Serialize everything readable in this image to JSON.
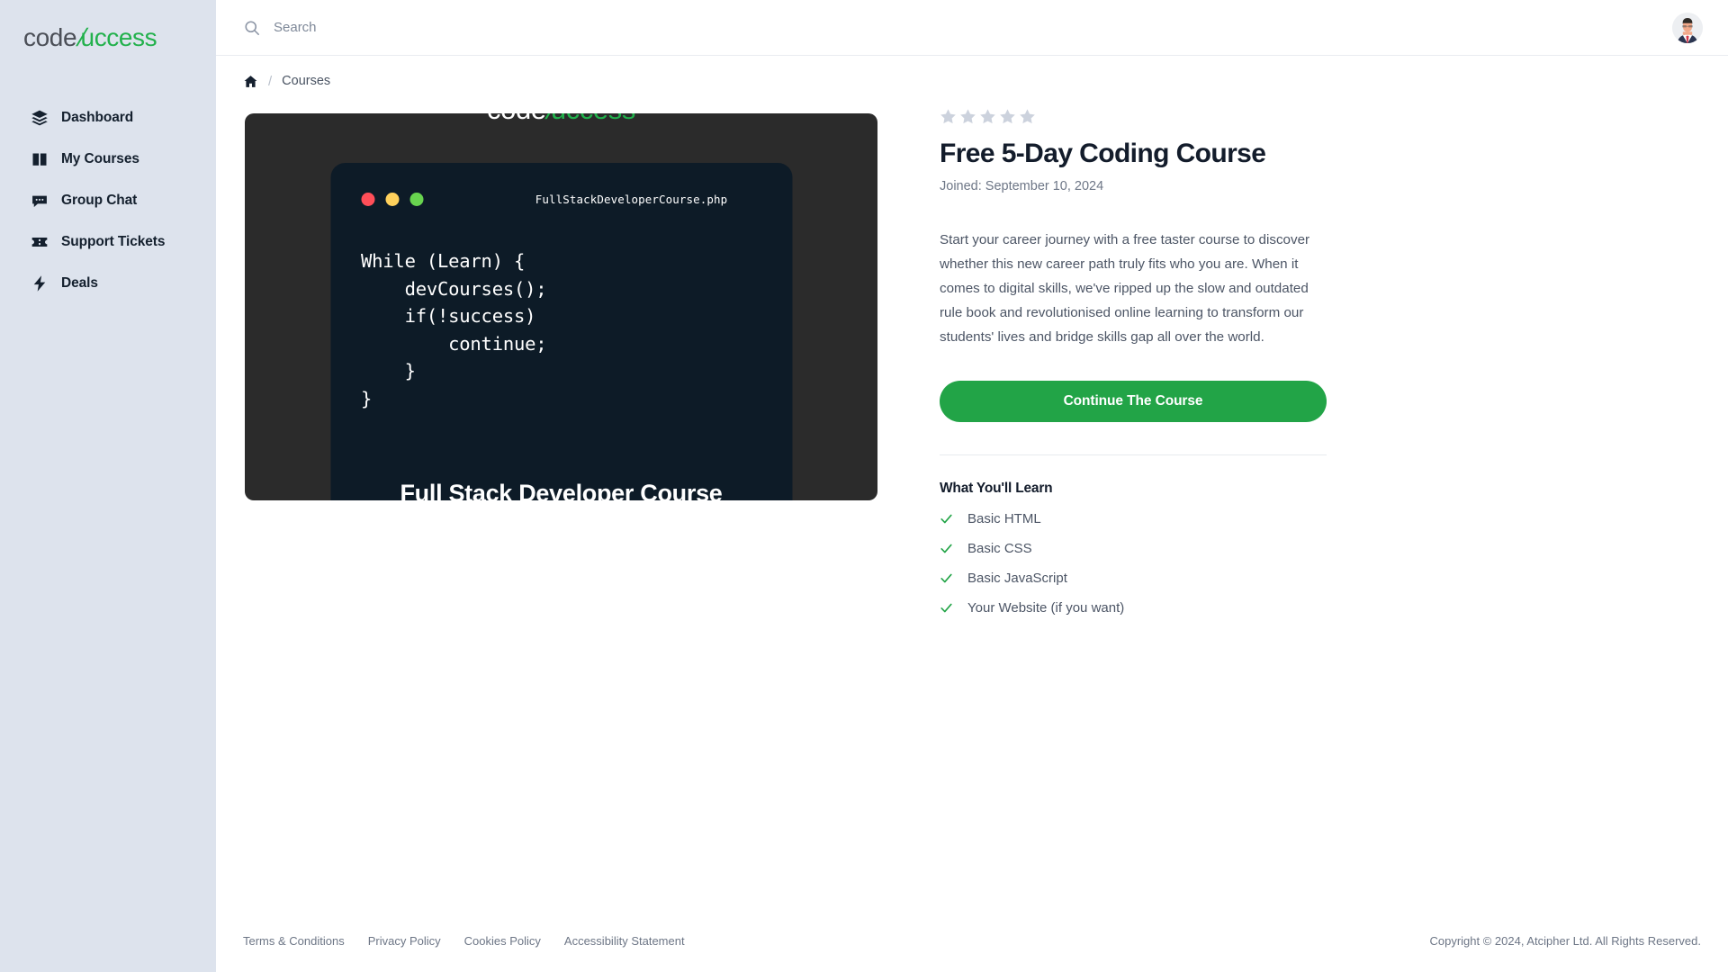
{
  "brand": {
    "name_prefix": "code",
    "name_slash": "/",
    "name_suffix": "uccess"
  },
  "sidebar": {
    "items": [
      {
        "label": "Dashboard",
        "icon": "layers-icon"
      },
      {
        "label": "My Courses",
        "icon": "book-icon"
      },
      {
        "label": "Group Chat",
        "icon": "chat-icon"
      },
      {
        "label": "Support Tickets",
        "icon": "ticket-icon"
      },
      {
        "label": "Deals",
        "icon": "bolt-icon"
      }
    ]
  },
  "topbar": {
    "search_placeholder": "Search",
    "search_value": "",
    "search_icon": "search-icon",
    "avatar_icon": "user-avatar"
  },
  "breadcrumb": {
    "home_icon": "home-icon",
    "separator": "/",
    "current": "Courses"
  },
  "promo": {
    "logo_prefix": "code",
    "logo_slash": "/",
    "logo_suffix": "uccess",
    "filename": "FullStackDeveloperCourse.php",
    "code": "While (Learn) {\n    devCourses();\n    if(!success)\n        continue;\n    }\n}",
    "caption": "Full Stack Developer Course",
    "dots": [
      "red",
      "yellow",
      "green"
    ],
    "colors": {
      "card_bg": "#2b2b2b",
      "window_bg": "#0d1b27",
      "dot_red": "#ff4e58",
      "dot_yellow": "#ffd15c",
      "dot_green": "#68d44f"
    }
  },
  "course": {
    "rating_stars_total": 5,
    "rating_stars_filled": 0,
    "star_color": "#ccd2dd",
    "title": "Free 5-Day Coding Course",
    "joined": "Joined: September 10, 2024",
    "description": "Start your career journey with a free taster course to discover whether this new career path truly fits who you are. When it comes to digital skills, we've ripped up the slow and outdated rule book and revolutionised online learning to transform our students' lives and bridge skills gap all over the world.",
    "cta_label": "Continue The Course",
    "cta_color": "#22a447",
    "learn_heading": "What You'll Learn",
    "learn_items": [
      "Basic HTML",
      "Basic CSS",
      "Basic JavaScript",
      "Your Website (if you want)"
    ]
  },
  "footer": {
    "links": [
      "Terms & Conditions",
      "Privacy Policy",
      "Cookies Policy",
      "Accessibility Statement"
    ],
    "copyright": "Copyright © 2024, Atcipher Ltd. All Rights Reserved."
  }
}
